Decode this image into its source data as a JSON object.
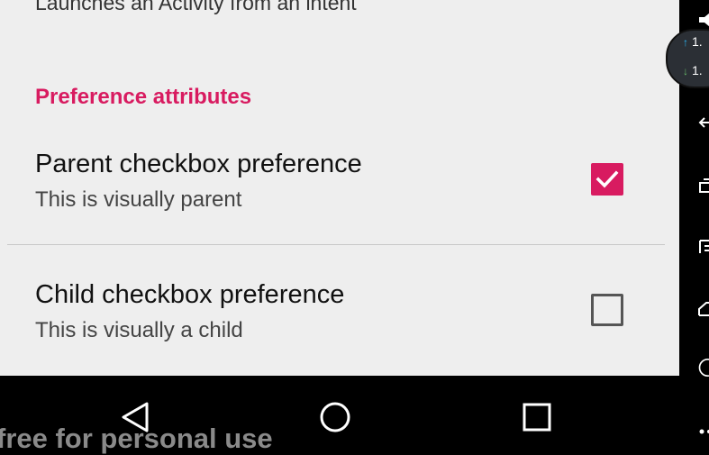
{
  "screen": {
    "top_summary": "Launches an Activity from an intent",
    "category_title": "Preference attributes",
    "preferences": [
      {
        "title": "Parent checkbox preference",
        "summary": "This is visually parent",
        "checked": true
      },
      {
        "title": "Child checkbox preference",
        "summary": "This is visually a child",
        "checked": false
      }
    ]
  },
  "colors": {
    "accent": "#d81b60",
    "background": "#eeeeee",
    "navbar": "#000000"
  },
  "navbar": {
    "buttons": [
      "back-icon",
      "home-icon",
      "recents-icon"
    ]
  },
  "watermark": "free for personal use",
  "side_panel": {
    "upload_speed": "1.",
    "download_speed": "1.",
    "icons": [
      "volume-icon",
      "back-arrow-icon",
      "crop-icon",
      "list-icon",
      "home-outline-icon",
      "circle-icon",
      "dots-icon"
    ]
  }
}
